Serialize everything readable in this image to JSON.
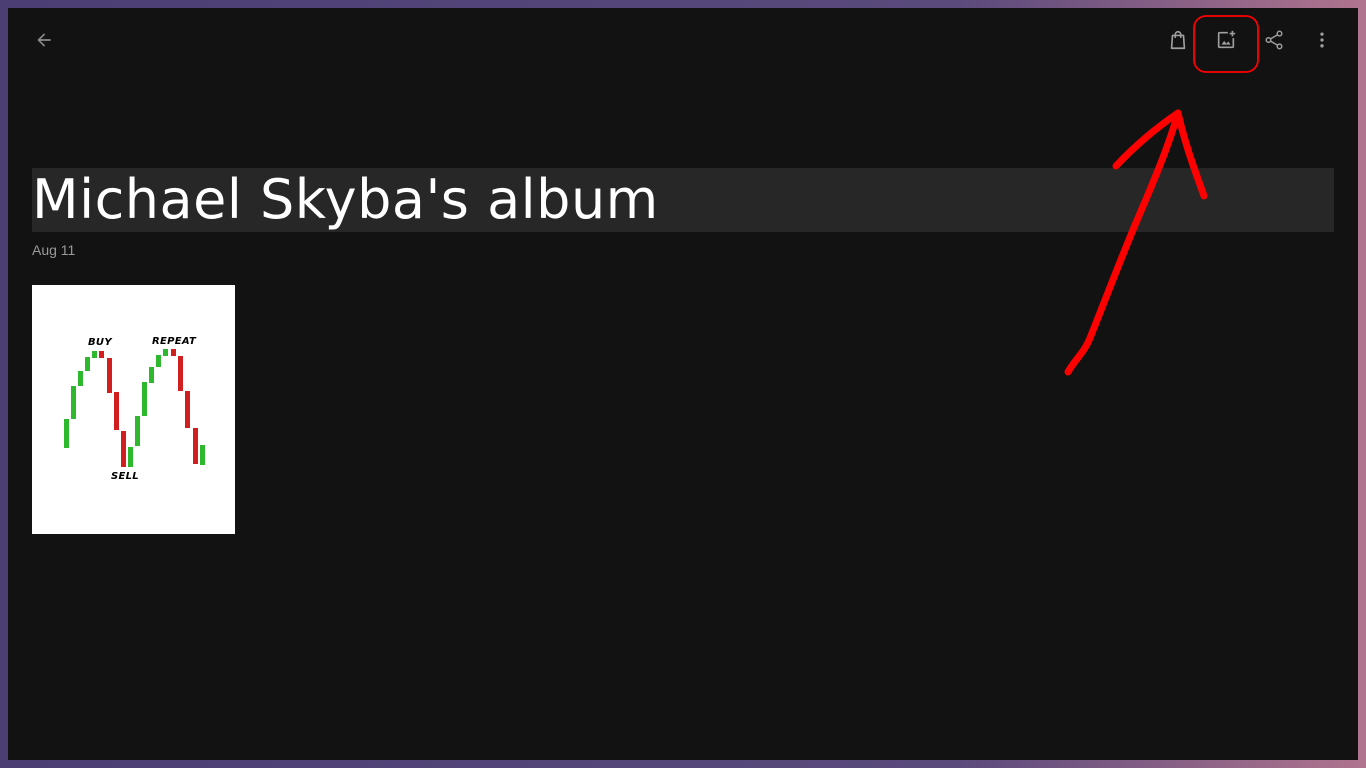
{
  "header": {
    "back_icon": "arrow-back-icon",
    "actions": [
      {
        "name": "shopping-bag-icon"
      },
      {
        "name": "add-photo-icon"
      },
      {
        "name": "share-icon"
      },
      {
        "name": "more-vert-icon"
      }
    ]
  },
  "album": {
    "title": "Michael Skyba's album",
    "date": "Aug 11"
  },
  "photo": {
    "labels": {
      "buy": "BUY",
      "repeat": "REPEAT",
      "sell": "SELL"
    }
  },
  "colors": {
    "background": "#121212",
    "title_bar": "#272727",
    "icon": "#9e9e9e",
    "annotation": "#ff0000",
    "candle_up": "#2db82d",
    "candle_down": "#d11f1f"
  }
}
